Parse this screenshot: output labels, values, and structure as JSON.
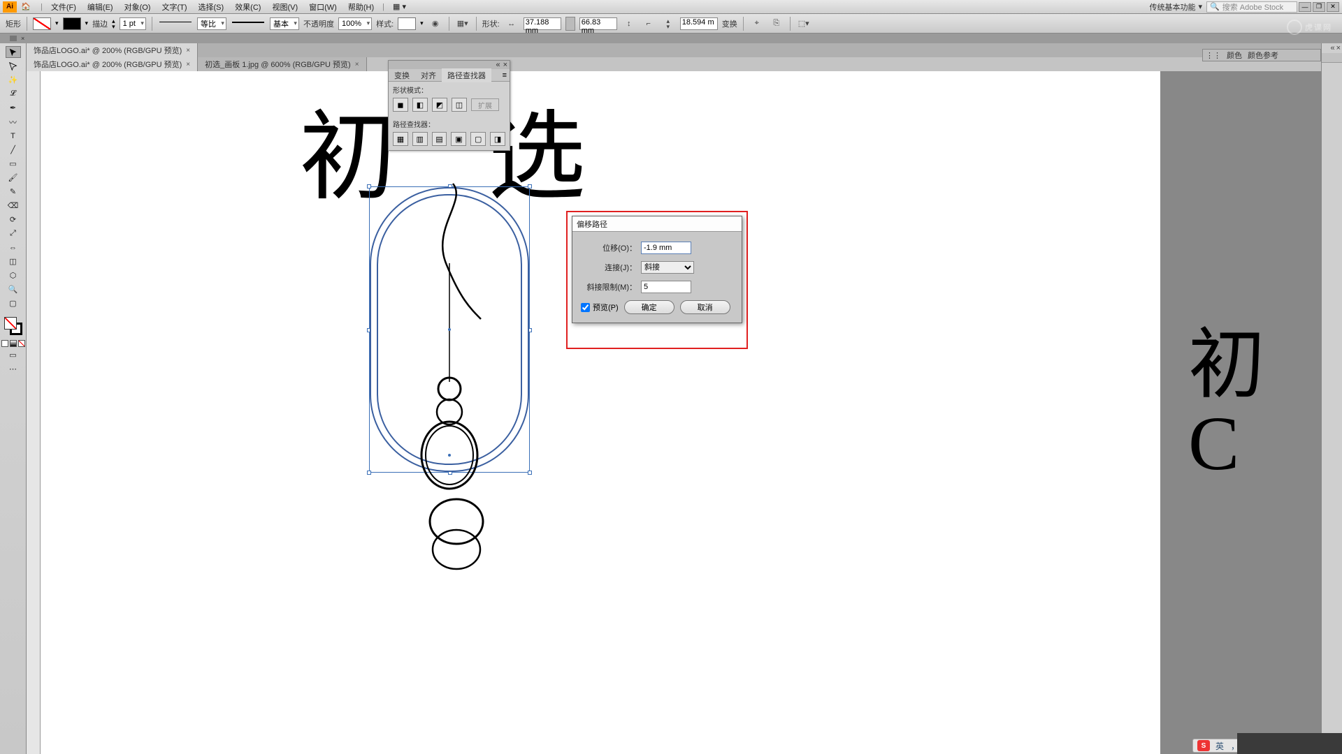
{
  "menubar": {
    "items": [
      "文件(F)",
      "编辑(E)",
      "对象(O)",
      "文字(T)",
      "选择(S)",
      "效果(C)",
      "视图(V)",
      "窗口(W)",
      "帮助(H)"
    ],
    "workspace": "传统基本功能",
    "search_placeholder": "搜索 Adobe Stock"
  },
  "controlbar": {
    "shape_label": "矩形",
    "stroke_label": "描边",
    "stroke_weight": "1 pt",
    "stroke_profile": "等比",
    "stroke_basic": "基本",
    "opacity_label": "不透明度",
    "opacity_value": "100%",
    "style_label": "样式:",
    "shape_panel": "形状:",
    "width": "37.188 mm",
    "height": "66.83 mm",
    "corner": "18.594 m",
    "transform_label": "变换"
  },
  "doc_tabs": {
    "tab1": "饰品店LOGO.ai* @ 200% (RGB/GPU 预览)",
    "tab1b": "饰品店LOGO.ai* @ 200% (RGB/GPU 预览)",
    "tab2": "初选_画板 1.jpg @ 600% (RGB/GPU 预览)"
  },
  "canvas_text": {
    "left": "初",
    "right": "选"
  },
  "side_art": {
    "char": "初",
    "latin": "C"
  },
  "pathfinder": {
    "tabs": [
      "变换",
      "对齐",
      "路径查找器"
    ],
    "section1": "形状模式：",
    "section2": "路径查找器：",
    "expand": "扩展"
  },
  "right_panel": {
    "tabs": [
      "颜色",
      "颜色参考"
    ]
  },
  "dialog": {
    "title": "偏移路径",
    "offset_label": "位移(O)：",
    "offset_value": "-1.9 mm",
    "join_label": "连接(J)：",
    "join_value": "斜接",
    "miter_label": "斜接限制(M)：",
    "miter_value": "5",
    "preview": "预览(P)",
    "ok": "确定",
    "cancel": "取消"
  },
  "ime": {
    "lang": "英",
    "punct": "，"
  },
  "watermark": "虎课网"
}
